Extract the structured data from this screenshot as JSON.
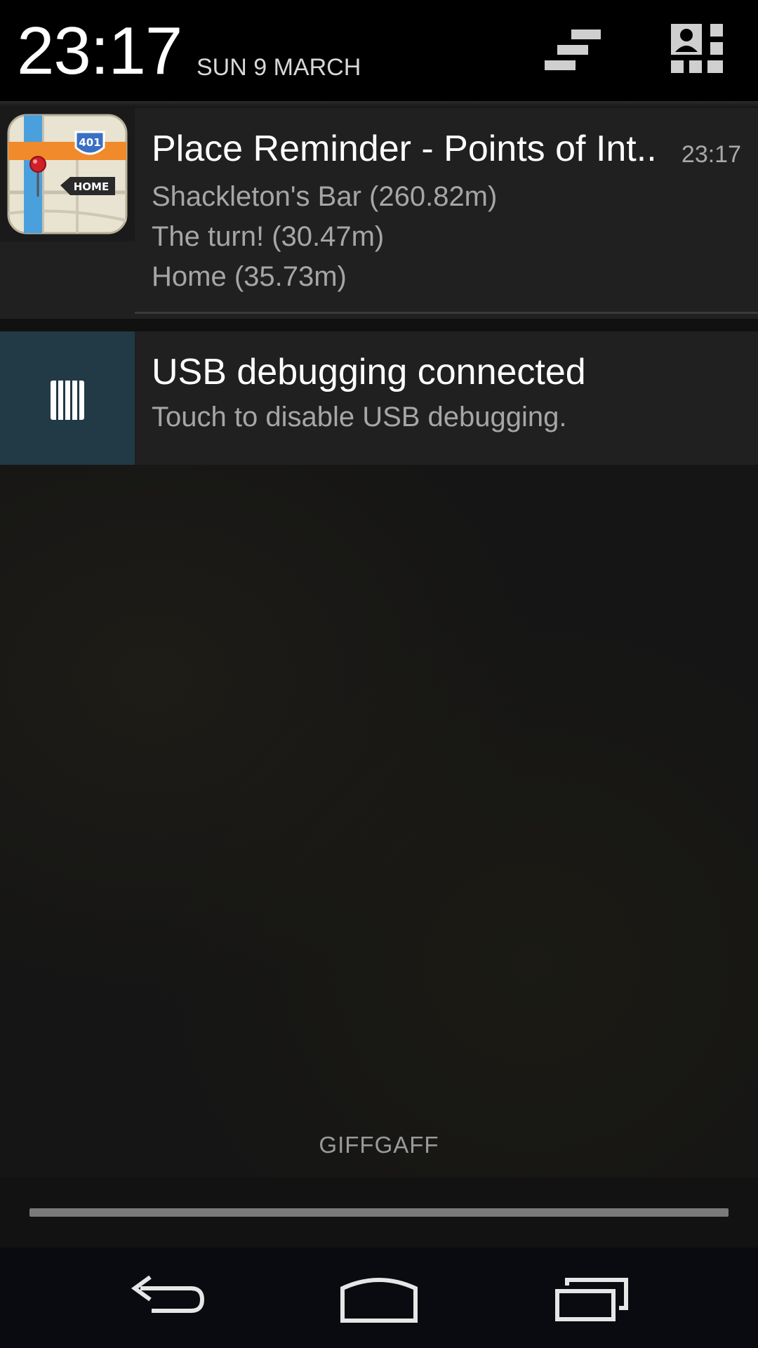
{
  "header": {
    "time": "23:17",
    "date": "SUN 9 MARCH",
    "icons": [
      "clear-all-icon",
      "quick-settings-icon"
    ]
  },
  "notifications": [
    {
      "app_icon": "place-reminder-map-icon",
      "title": "Place Reminder - Points of Int..",
      "time": "23:17",
      "lines": [
        "Shackleton's Bar (260.82m)",
        "The turn! (30.47m)",
        "Home (35.73m)"
      ]
    },
    {
      "app_icon": "usb-debug-icon",
      "title": "USB debugging connected",
      "text": "Touch to disable USB debugging."
    }
  ],
  "carrier": "GIFFGAFF",
  "navbar": {
    "icons": [
      "back-icon",
      "home-icon",
      "recent-apps-icon"
    ]
  },
  "colors": {
    "header_bg": "#000000",
    "notification_bg": "#202020",
    "usb_icon_bg": "#213a45",
    "handle": "#7a7a7a"
  }
}
